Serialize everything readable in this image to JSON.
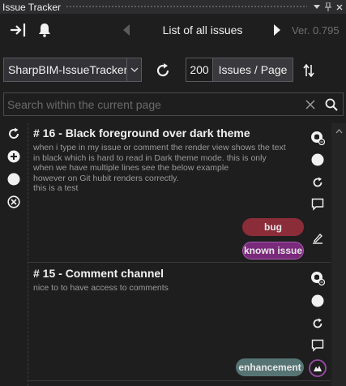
{
  "window": {
    "title": "Issue Tracker"
  },
  "toolbar": {
    "list_title": "List of all issues",
    "version": "Ver. 0.795"
  },
  "project": {
    "selected": "SharpBIM-IssueTracker",
    "per_page_value": "200",
    "per_page_label": "Issues / Page"
  },
  "search": {
    "placeholder": "Search within the current page"
  },
  "issues": [
    {
      "title": "# 16 - Black foreground over dark theme",
      "body": [
        "when i type  in my issue or comment the render view shows the text",
        "in black which is hard to read in Dark theme mode.  this is only",
        "when we have multiple lines see the below example",
        "however on Git hubit renders correctly.",
        "this is a test"
      ],
      "labels": [
        "bug",
        "known issue"
      ]
    },
    {
      "title": "# 15 - Comment channel",
      "body": [
        "nice to to have access to comments"
      ],
      "labels": [
        "enhancement"
      ]
    }
  ],
  "colors": {
    "bug": "#8b2c39",
    "known_issue": "#7a2a7a",
    "enhancement": "#577474",
    "background": "#1e1e1e"
  }
}
